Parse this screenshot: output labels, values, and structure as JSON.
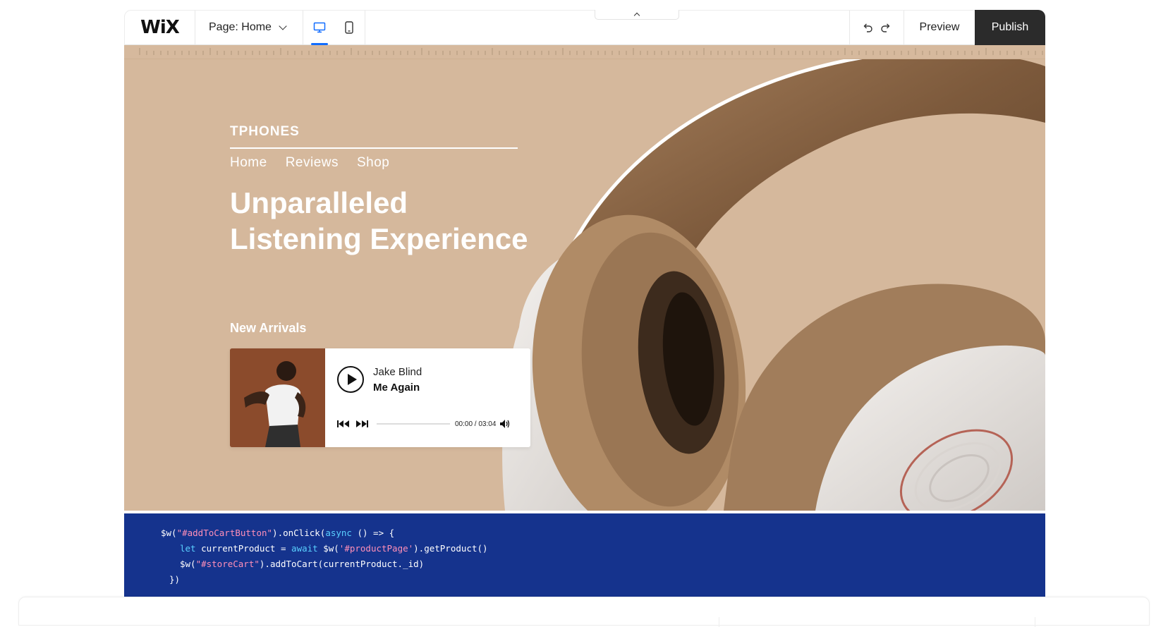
{
  "toolbar": {
    "logo": "WiX",
    "page_label": "Page: Home",
    "preview_label": "Preview",
    "publish_label": "Publish",
    "active_device": "desktop"
  },
  "site": {
    "brand": "TPHONES",
    "nav": [
      "Home",
      "Reviews",
      "Shop"
    ],
    "headline_line1": "Unparalleled",
    "headline_line2": "Listening Experience",
    "section_title": "New Arrivals",
    "background_color": "#d5b89c"
  },
  "player": {
    "artist": "Jake Blind",
    "song": "Me Again",
    "time": "00:00 / 03:04",
    "progress": 0
  },
  "code": {
    "lines": [
      [
        "$w(",
        "\"#addToCartButton\"",
        ").onClick(",
        "async",
        " () => {"
      ],
      [
        "let",
        " currentProduct = ",
        "await",
        " $w(",
        "'#productPage'",
        ").getProduct()"
      ],
      [
        "$w(",
        "\"#storeCart\"",
        ").addToCart(currentProduct._id)"
      ],
      [
        "})"
      ]
    ],
    "background_color": "#15338d"
  },
  "icons": [
    "desktop-icon",
    "mobile-icon",
    "undo-icon",
    "redo-icon",
    "chevron-down-icon",
    "chevron-up-icon",
    "play-icon",
    "previous-icon",
    "next-icon",
    "volume-icon"
  ]
}
